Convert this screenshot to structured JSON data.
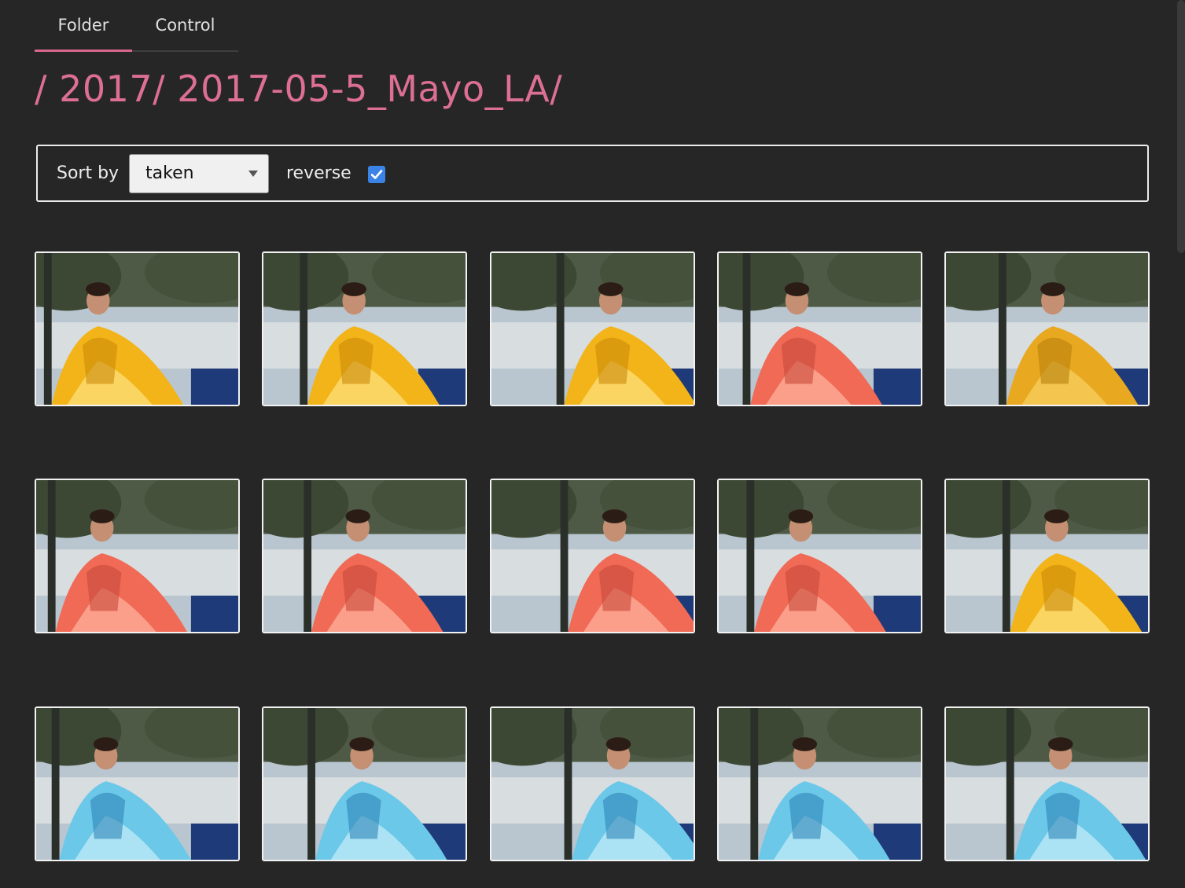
{
  "tabs": [
    {
      "label": "Folder",
      "active": true
    },
    {
      "label": "Control",
      "active": false
    }
  ],
  "path": "/ 2017/ 2017-05-5_Mayo_LA/",
  "sort": {
    "label": "Sort by",
    "selected": "taken",
    "reverse_label": "reverse",
    "reverse_checked": true
  },
  "colors": {
    "accent": "#dc6f93",
    "checkbox": "#3b83e6",
    "background": "#262626"
  },
  "photos": [
    {
      "dress": "yellow"
    },
    {
      "dress": "yellow"
    },
    {
      "dress": "yellow"
    },
    {
      "dress": "coral"
    },
    {
      "dress": "gold"
    },
    {
      "dress": "coral"
    },
    {
      "dress": "coral"
    },
    {
      "dress": "coral"
    },
    {
      "dress": "coral"
    },
    {
      "dress": "yellow"
    },
    {
      "dress": "turquoise"
    },
    {
      "dress": "turquoise"
    },
    {
      "dress": "turquoise"
    },
    {
      "dress": "turquoise"
    },
    {
      "dress": "turquoise"
    }
  ]
}
